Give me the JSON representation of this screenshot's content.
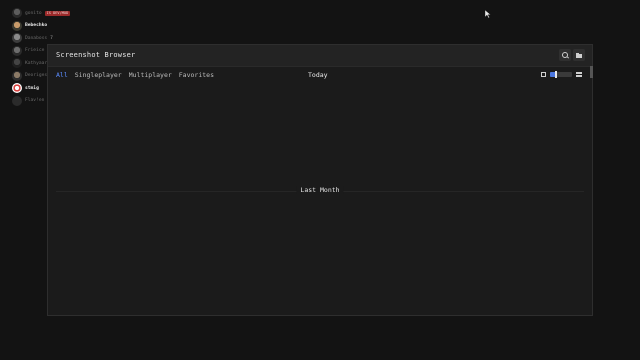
{
  "friends": [
    {
      "name": "gonito",
      "badge": "IS DEV/MOD",
      "avatar": "a0",
      "style": "dim"
    },
    {
      "name": "Bebechko",
      "avatar": "a1",
      "style": "bright"
    },
    {
      "name": "Danaboss",
      "count": "7",
      "avatar": "a2",
      "style": "dim"
    },
    {
      "name": "Frieice",
      "avatar": "a3",
      "style": "dim"
    },
    {
      "name": "Kathyaarik",
      "count": "2",
      "avatar": "a4",
      "style": "dim"
    },
    {
      "name": "Deoriges",
      "count": "2",
      "avatar": "a5",
      "style": "dim"
    },
    {
      "name": "stmig",
      "avatar": "a6",
      "style": "bright"
    },
    {
      "name": "Flav!en",
      "avatar": "a7",
      "style": "dim"
    }
  ],
  "window": {
    "title": "Screenshot Browser",
    "search_icon": "search-icon",
    "folder_icon": "folder-icon",
    "tabs": [
      {
        "label": "All",
        "active": true
      },
      {
        "label": "Singleplayer",
        "active": false
      },
      {
        "label": "Multiplayer",
        "active": false
      },
      {
        "label": "Favorites",
        "active": false
      }
    ],
    "today_label": "Today",
    "zoom_level": 0.25,
    "section_label": "Last Month"
  },
  "colors": {
    "accent": "#5b8cff",
    "badge": "#9b2a2a",
    "background": "#131313",
    "panel": "#1b1b1b"
  }
}
